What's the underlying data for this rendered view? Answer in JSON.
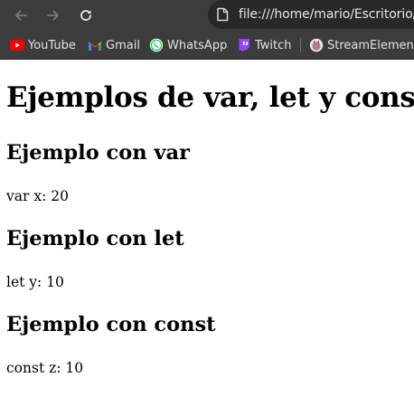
{
  "browser": {
    "url": "file:///home/mario/Escritorio/",
    "bookmarks": [
      {
        "label": "YouTube",
        "icon": "youtube-icon",
        "color": "#ff0000"
      },
      {
        "label": "Gmail",
        "icon": "gmail-icon",
        "color": "#ea4335"
      },
      {
        "label": "WhatsApp",
        "icon": "whatsapp-icon",
        "color": "#25d366"
      },
      {
        "label": "Twitch",
        "icon": "twitch-icon",
        "color": "#9146ff"
      },
      {
        "label": "StreamElements",
        "icon": "streamelements-icon",
        "color": "#b07a8c"
      }
    ],
    "toolbar_bg": "#3c3c3c",
    "address_bg": "#282828"
  },
  "page": {
    "title": "Ejemplos de var, let y const",
    "sections": [
      {
        "heading": "Ejemplo con var",
        "text": "var x: 20"
      },
      {
        "heading": "Ejemplo con let",
        "text": "let y: 10"
      },
      {
        "heading": "Ejemplo con const",
        "text": "const z: 10"
      }
    ]
  }
}
